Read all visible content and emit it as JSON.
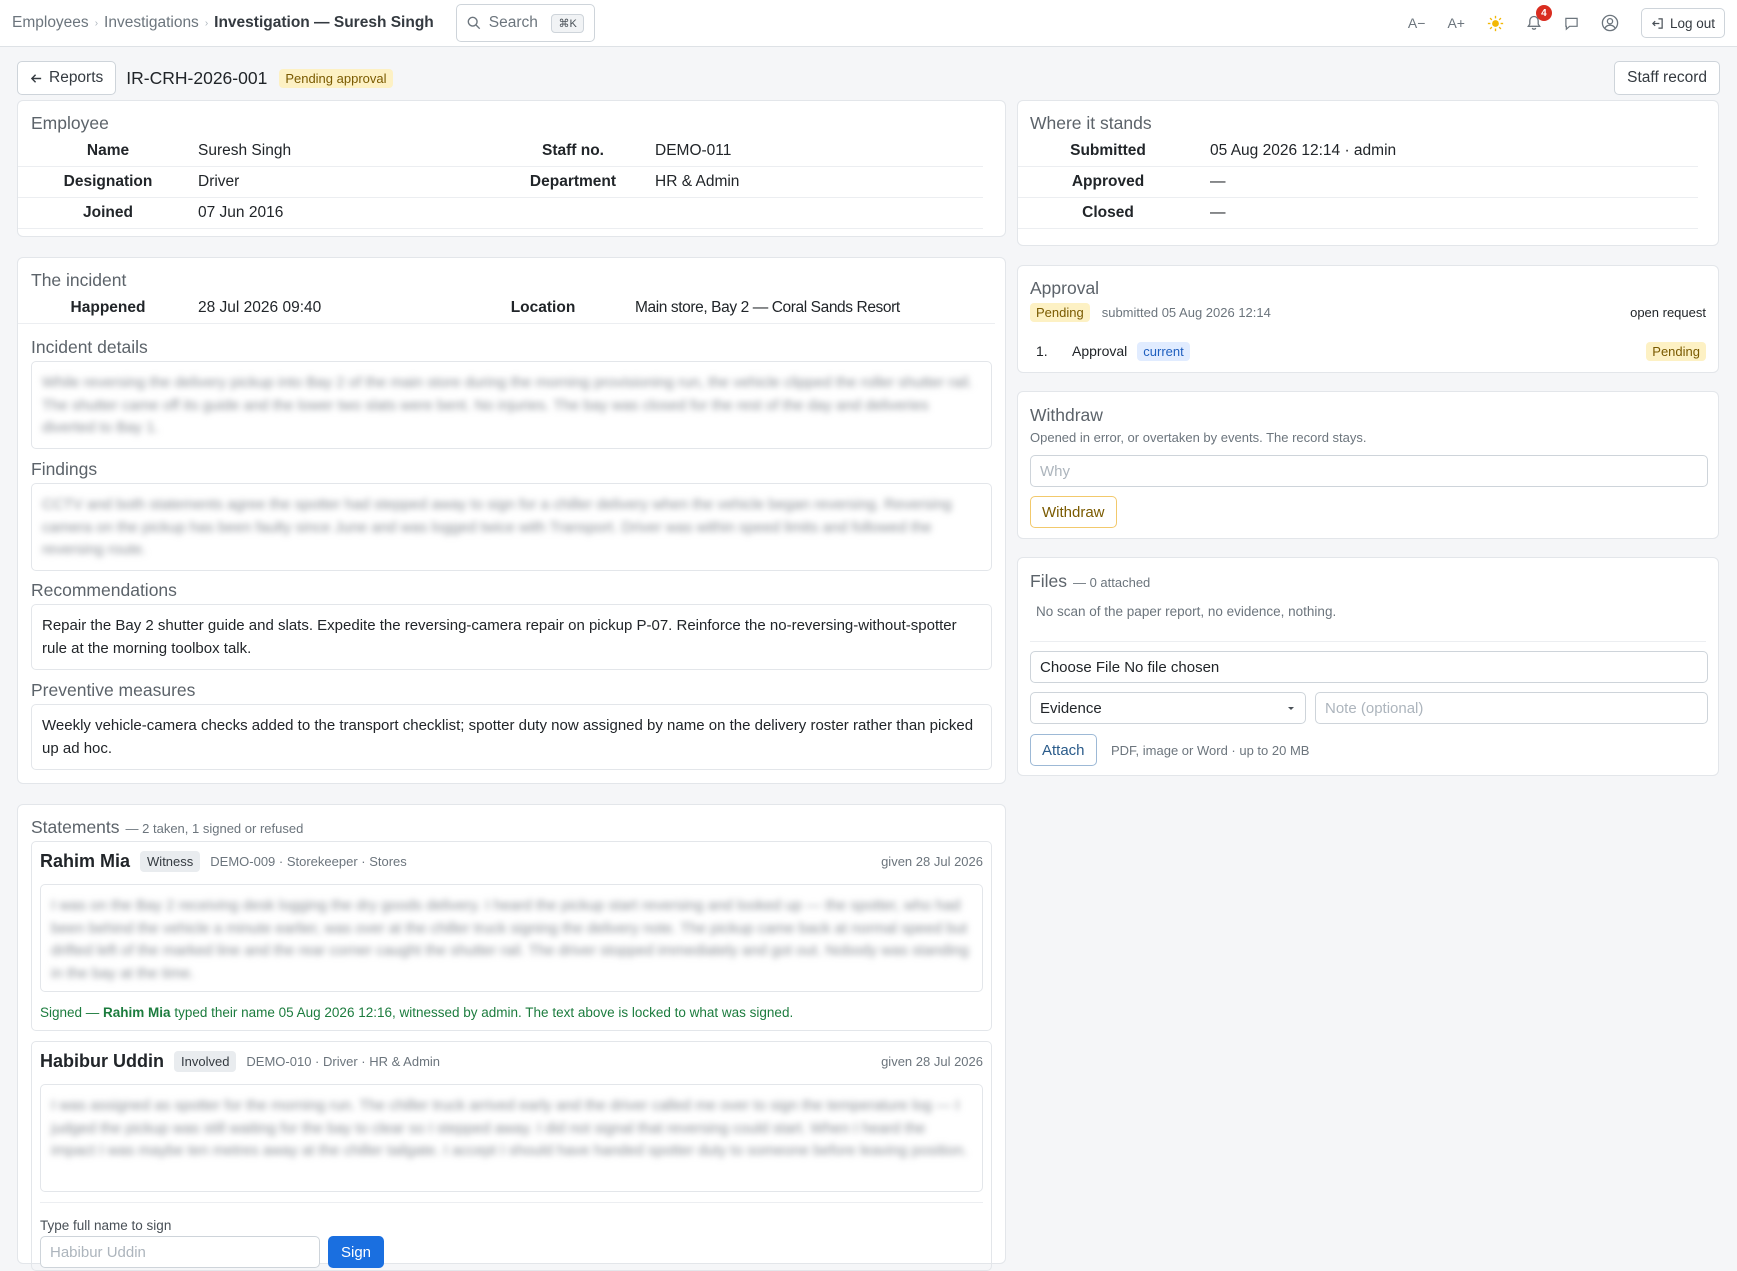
{
  "breadcrumb": [
    "Employees",
    "Investigations",
    "Investigation — Suresh Singh"
  ],
  "search": {
    "label": "Search",
    "shortcut": "⌘K"
  },
  "topbar": {
    "font_smaller": "A−",
    "font_larger": "A+",
    "notifications_count": "4",
    "logout": "Log out"
  },
  "header": {
    "back_label": "Reports",
    "record_id": "IR-CRH-2026-001",
    "status": "Pending approval",
    "staff_record": "Staff record"
  },
  "employee": {
    "title": "Employee",
    "name_label": "Name",
    "name": "Suresh Singh",
    "staff_no_label": "Staff no.",
    "staff_no": "DEMO-011",
    "designation_label": "Designation",
    "designation": "Driver",
    "department_label": "Department",
    "department": "HR & Admin",
    "joined_label": "Joined",
    "joined": "07 Jun 2016"
  },
  "status": {
    "title": "Where it stands",
    "submitted_label": "Submitted",
    "submitted": "05 Aug 2026 12:14 · admin",
    "approved_label": "Approved",
    "approved": "—",
    "closed_label": "Closed",
    "closed": "—"
  },
  "incident": {
    "title": "The incident",
    "happened_label": "Happened",
    "happened": "28 Jul 2026 09:40",
    "location_label": "Location",
    "location": "Main store, Bay 2 — Coral Sands Resort",
    "details_title": "Incident details",
    "details": "While reversing the delivery pickup into Bay 2 of the main store during the morning provisioning run, the vehicle clipped the roller shutter rail. The shutter came off its guide and the lower two slats were bent. No injuries. The bay was closed for the rest of the day and deliveries diverted to Bay 1.",
    "findings_title": "Findings",
    "findings": "CCTV and both statements agree the spotter had stepped away to sign for a chiller delivery when the vehicle began reversing. Reversing camera on the pickup has been faulty since June and was logged twice with Transport. Driver was within speed limits and followed the reversing route.",
    "recommendations_title": "Recommendations",
    "recommendations": "Repair the Bay 2 shutter guide and slats. Expedite the reversing-camera repair on pickup P-07. Reinforce the no-reversing-without-spotter rule at the morning toolbox talk.",
    "preventive_title": "Preventive measures",
    "preventive": "Weekly vehicle-camera checks added to the transport checklist; spotter duty now assigned by name on the delivery roster rather than picked up ad hoc."
  },
  "approval": {
    "title": "Approval",
    "status": "Pending",
    "submitted": "submitted 05 Aug 2026 12:14",
    "open_request": "open request",
    "steps": [
      {
        "num": "1.",
        "label": "Approval",
        "tag": "current",
        "status": "Pending"
      }
    ]
  },
  "withdraw": {
    "title": "Withdraw",
    "desc": "Opened in error, or overtaken by events. The record stays.",
    "placeholder": "Why",
    "button": "Withdraw"
  },
  "files": {
    "title": "Files",
    "count": "— 0 attached",
    "empty": "No scan of the paper report, no evidence, nothing.",
    "file_input": "Choose File No file chosen",
    "type_select": "Evidence",
    "note_placeholder": "Note (optional)",
    "attach": "Attach",
    "hint": "PDF, image or Word · up to 20 MB"
  },
  "statements": {
    "title": "Statements",
    "count": "— 2 taken, 1 signed or refused",
    "items": [
      {
        "name": "Rahim Mia",
        "role": "Witness",
        "meta": "DEMO-009 · Storekeeper · Stores",
        "given": "given 28 Jul 2026",
        "text": "I was on the Bay 2 receiving desk logging the dry goods delivery. I heard the pickup start reversing and looked up — the spotter, who had been behind the vehicle a minute earlier, was over at the chiller truck signing the delivery note. The pickup came back at normal speed but drifted left of the marked line and the rear corner caught the shutter rail. The driver stopped immediately and got out. Nobody was standing in the bay at the time.",
        "signed_prefix": "Signed — ",
        "signed_name": "Rahim Mia",
        "signed_suffix": " typed their name 05 Aug 2026 12:16, witnessed by admin. The text above is locked to what was signed."
      },
      {
        "name": "Habibur Uddin",
        "role": "Involved",
        "meta": "DEMO-010 · Driver · HR & Admin",
        "given": "given 28 Jul 2026",
        "text": "I was assigned as spotter for the morning run. The chiller truck arrived early and the driver called me over to sign the temperature log — I judged the pickup was still waiting for the bay to clear so I stepped away. I did not signal that reversing could start. When I heard the impact I was maybe ten metres away at the chiller tailgate. I accept I should have handed spotter duty to someone before leaving position.",
        "sign_label": "Type full name to sign",
        "sign_placeholder": "Habibur Uddin",
        "sign_button": "Sign"
      }
    ]
  }
}
